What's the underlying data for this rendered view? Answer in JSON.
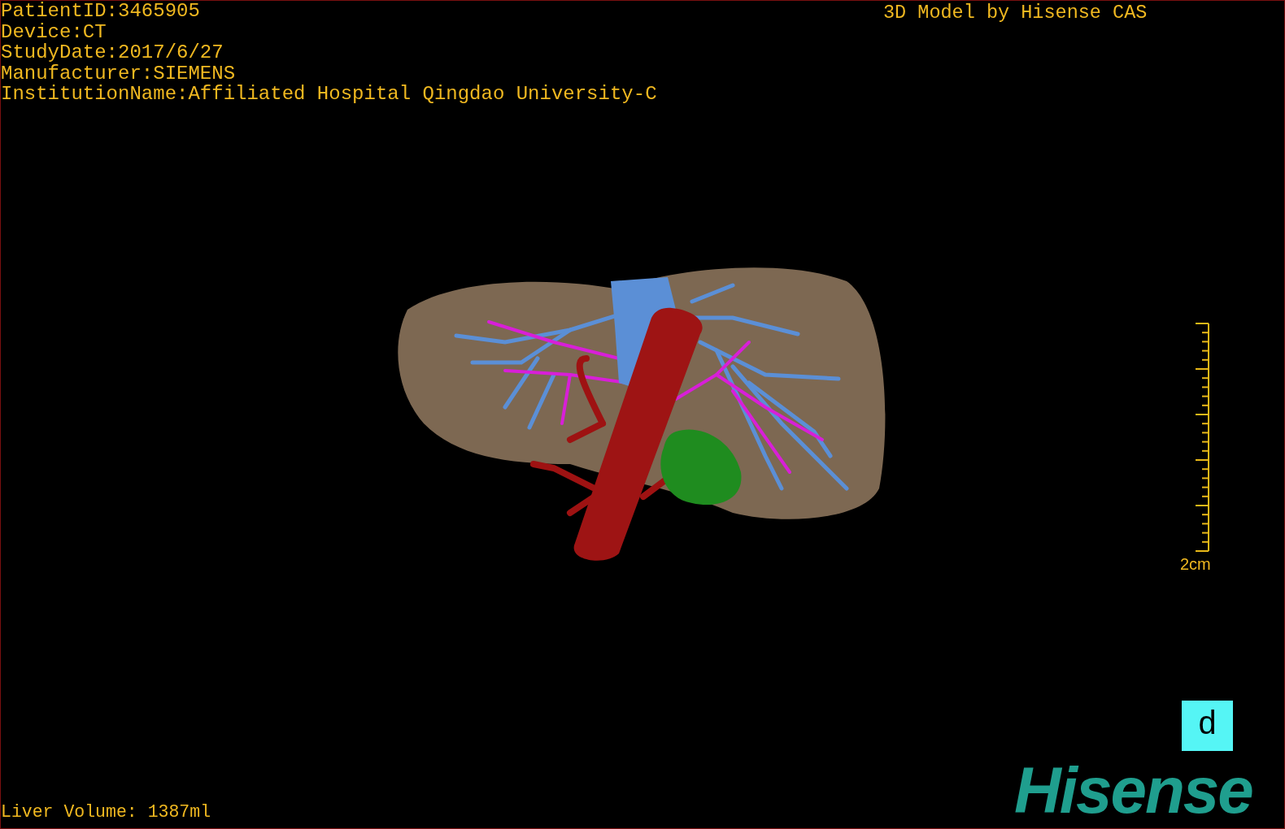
{
  "study_info": [
    "PatientID:3465905",
    "Device:CT",
    "StudyDate:2017/6/27",
    "Manufacturer:SIEMENS",
    "InstitutionName:Affiliated Hospital Qingdao University-C"
  ],
  "model_credit": "3D Model by Hisense CAS",
  "scale_bar": {
    "label": "2cm"
  },
  "orientation_cube": {
    "label": "d"
  },
  "liver_volume": "Liver Volume: 1387ml",
  "logo": "Hisense"
}
